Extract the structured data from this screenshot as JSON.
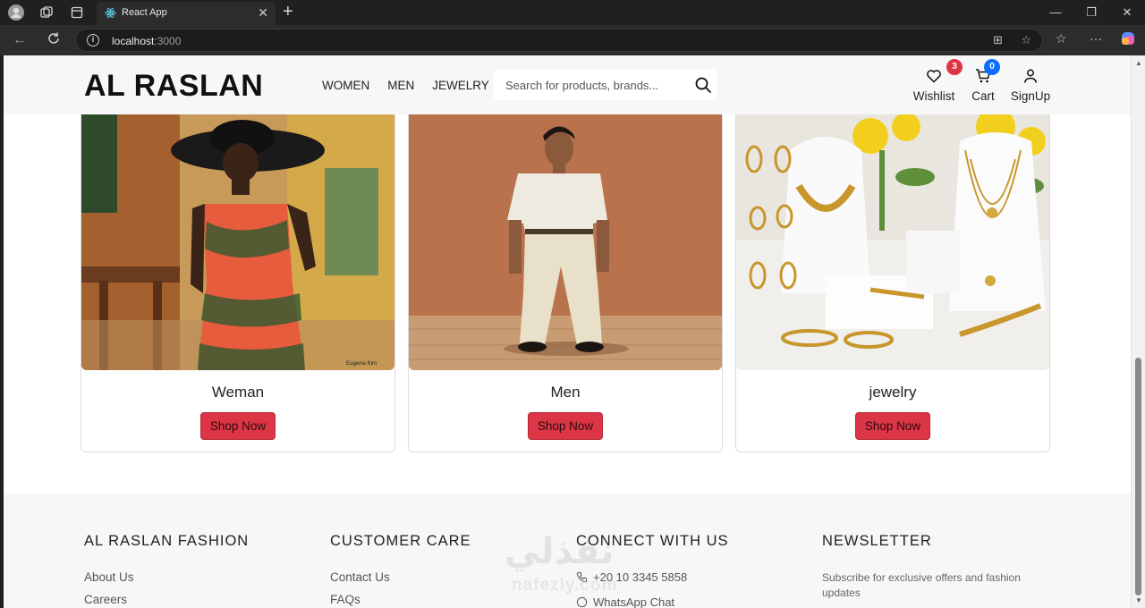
{
  "browser": {
    "tab_title": "React App",
    "url_host": "localhost",
    "url_port": ":3000"
  },
  "header": {
    "brand": "AL RASLAN",
    "nav": [
      "WOMEN",
      "MEN",
      "JEWELRY"
    ],
    "search_placeholder": "Search for products, brands...",
    "wishlist": {
      "label": "Wishlist",
      "count": "3"
    },
    "cart": {
      "label": "Cart",
      "count": "0"
    },
    "signup": {
      "label": "SignUp"
    }
  },
  "categories": [
    {
      "name": "Weman",
      "button": "Shop Now",
      "image": "woman-in-floral-dress-photo"
    },
    {
      "name": "Men",
      "button": "Shop Now",
      "image": "man-in-cream-outfit-photo"
    },
    {
      "name": "jewelry",
      "button": "Shop Now",
      "image": "gold-jewelry-display-photo"
    }
  ],
  "footer": {
    "col1": {
      "title": "AL RASLAN FASHION",
      "links": [
        "About Us",
        "Careers"
      ]
    },
    "col2": {
      "title": "CUSTOMER CARE",
      "links": [
        "Contact Us",
        "FAQs"
      ]
    },
    "col3": {
      "title": "CONNECT WITH US",
      "phone": "+20 10 3345 5858",
      "whatsapp": "WhatsApp Chat"
    },
    "col4": {
      "title": "NEWSLETTER",
      "text": "Subscribe for exclusive offers and fashion updates"
    }
  },
  "watermark": {
    "arabic": "نفذلي",
    "latin": "nafezly.com"
  },
  "colors": {
    "accent": "#dc3545",
    "wishlist_badge": "#dc3545",
    "cart_badge": "#0d6efd",
    "header_bg": "#f7f7f8"
  }
}
